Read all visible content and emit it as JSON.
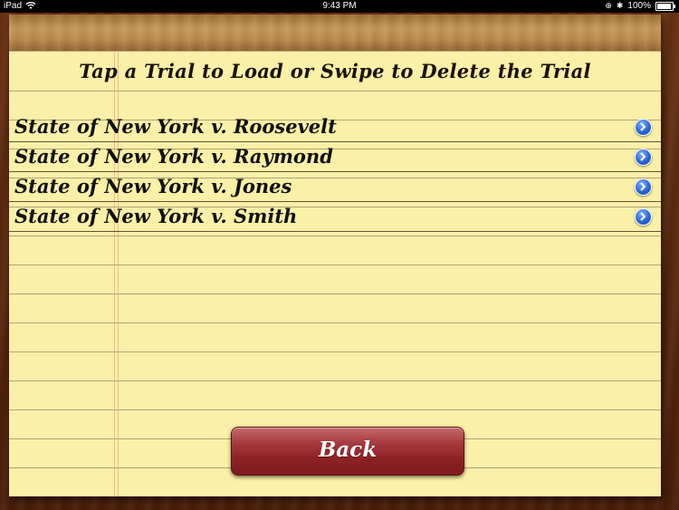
{
  "status_bar": {
    "device": "iPad",
    "time": "9:43 PM",
    "battery": "100%"
  },
  "page": {
    "title": "Tap a Trial to Load or Swipe to Delete the Trial"
  },
  "trials": [
    {
      "label": "State of New York v. Roosevelt",
      "icon": "disclosure-icon"
    },
    {
      "label": "State of New York v. Raymond",
      "icon": "disclosure-icon"
    },
    {
      "label": "State of New York v. Jones",
      "icon": "disclosure-icon"
    },
    {
      "label": "State of New York v. Smith",
      "icon": "disclosure-icon"
    }
  ],
  "actions": {
    "back_label": "Back"
  },
  "colors": {
    "paper": "#faf0a8",
    "wood": "#5a2a12",
    "back_button": "#8e2226",
    "disclosure": "#2a66d6"
  }
}
